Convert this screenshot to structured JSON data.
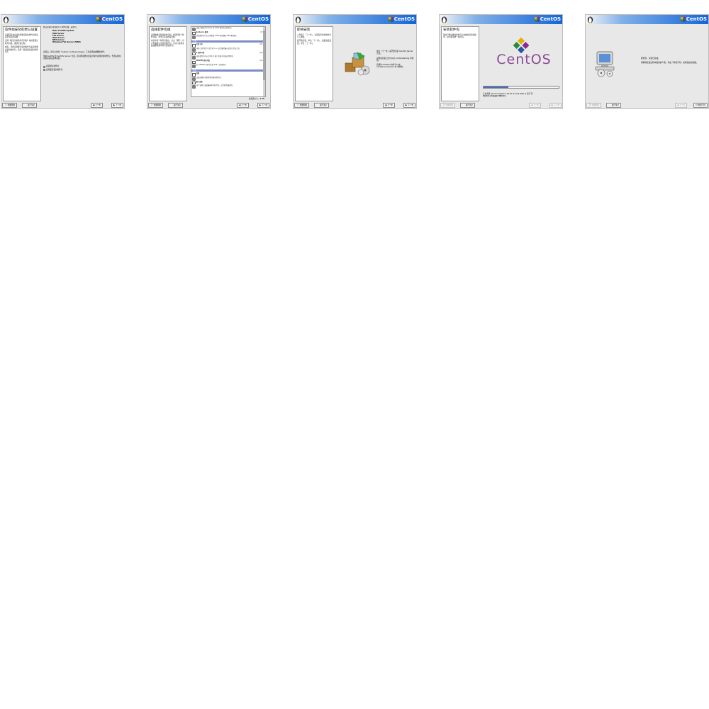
{
  "colors": {
    "banner_dark": "#1565d8",
    "group_header": "#7f8bc9",
    "progress_fill": "#4f6bb8"
  },
  "brand": {
    "logo_text": "CentOS",
    "icon": "tux-penguin-icon"
  },
  "buttons": {
    "help": "隐藏帮助",
    "notes": "发行注记",
    "back": "上一步",
    "next": "下一步",
    "reboot": "重新引导"
  },
  "screens": [
    {
      "help_title": "软件组安装的默认设置",
      "help_body": [
        "安装程序会自动选择要安装的软件包组来满足常见的需要。",
        "选择【接受当前软件包列表】来接受默认软件包集，继续安装过程。",
        "或者，选择定制要安装的软件包来定制要安装的软件包，选择【定制要安装的软件包】。"
      ],
      "intro": "默认安装环境包括以下软件包组，其中有：",
      "groups": [
        "Base CentOS System",
        "Mail Server",
        "File Server",
        "Web Server",
        "DNS Server",
        "Windows File Server (SMB)"
      ],
      "note1": "安装后，您可以使用「system-config-packages」工具来添加或删除软件。",
      "note2": "但是CentOS 的 CentOS_Server 光盘，您可能需要在安装过程中选择定制软件包，否则只能在安装完成后选择添加。",
      "options": [
        "接受默认软件包",
        "定制要安装的软件包"
      ],
      "selected_option": 1
    },
    {
      "help_title": "选择软件包组",
      "help_body": [
        "选择你要安装的软件包组，要选择某个软件包组，单击它旁边的复选框。",
        "在选中某个软件包组后，点击「细节」可以查看默认安装的软件包，还可以选择安装或删除其中的可选软件包。"
      ],
      "rows": [
        {
          "kind": "pkg",
          "name": "",
          "desc": "安装与使用 Kerberos 和 LDAP 服务有关的软件。",
          "count": ""
        },
        {
          "kind": "pkg",
          "name": "Kerberos 服务",
          "desc": "",
          "count": "[0/1]"
        },
        {
          "kind": "pkg",
          "name": "",
          "desc": "这组软件包可以让你配置 DHCP 服务器和 DNS 服务器。",
          "count": ""
        },
        {
          "kind": "group",
          "name": "开发"
        },
        {
          "kind": "pkg",
          "name": "开发工具",
          "desc": "这些工具包括 C 语言和 C++ 语言编译器以及其它开发工具。",
          "count": "[0/13]"
        },
        {
          "kind": "pkg",
          "name": "X 软件开发",
          "desc": "这些软件包可以让你在 X 窗口系统中开发应用程序。",
          "count": "[0/23]"
        },
        {
          "kind": "pkg",
          "name": "GNOME 软件开发",
          "desc": "在 GNOME 环境中开发 GTK+ 应用程序。",
          "count": "[0/23]"
        },
        {
          "kind": "group",
          "name": "其它"
        },
        {
          "kind": "pkg",
          "name": "旧版",
          "desc": "安装旧版本系统所需的兼容程序库。",
          "count": ""
        },
        {
          "kind": "pkg",
          "name": "最小安装",
          "desc": "这个选项只安装最基本的软件包，适合服务器使用。",
          "count": ""
        }
      ],
      "total_label": "总安装大小：",
      "total_value": "1.7G"
    },
    {
      "help_title": "即将安装",
      "help_body": [
        "一旦按下「下一步」，安装程序会将软件包写入硬盘。",
        "要开始安装，单击「下一步」。如要改变设置，单击「上一步」。"
      ],
      "message": [
        "单击「下一步」来开始安装 CentOS_Server 光盘。",
        "完整的安装日志可以在 /root/install.log 中找到。",
        "完整的 kickstart 文件可以在 /root/anaconda-ks.cfg 中找到。"
      ]
    },
    {
      "help_title": "安装软件包",
      "help_body": [
        "现在已经选择的软件包正在被安装到系统中，这可能需要一些时间。"
      ],
      "status_line1": "正在安装 device-mapper-1.02.07-4.0.el5.i386 (1 兆字节)",
      "status_line2": "device mapper library",
      "progress": 0.33
    },
    {
      "message": [
        "祝贺您，安装已完成。",
        "请移除安装过程中使用的介质，单击「重新引导」来重新启动系统。"
      ]
    }
  ]
}
